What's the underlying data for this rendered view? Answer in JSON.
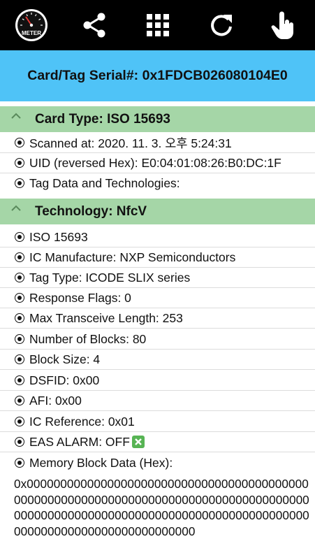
{
  "toolbar": {
    "meter_label": "METER",
    "icons": [
      "meter-icon",
      "share-icon",
      "grid-icon",
      "refresh-icon",
      "touch-icon"
    ]
  },
  "serial": {
    "text": "Card/Tag Serial#: 0x1FDCB026080104E0"
  },
  "card_section": {
    "title": "Card Type: ISO 15693",
    "items": [
      "Scanned at: 2020. 11. 3. 오후 5:24:31",
      "UID (reversed Hex): E0:04:01:08:26:B0:DC:1F",
      "Tag Data and Technologies:"
    ]
  },
  "tech_section": {
    "title": "Technology: NfcV",
    "items": [
      "ISO 15693",
      "IC Manufacture: NXP Semiconductors",
      "Tag Type: ICODE SLIX series",
      "Response Flags: 0",
      "Max Transceive Length: 253",
      "Number of Blocks: 80",
      "Block Size: 4",
      "DSFID: 0x00",
      "AFI: 0x00",
      "IC Reference: 0x01",
      "EAS ALARM: OFF",
      "Memory Block Data (Hex):"
    ]
  },
  "memory_hex": "0x0000000000000000000000000000000000000000000000000000000000000000000000000000000000000000000000000000000000000000000000000000000000000000000000000000000000000",
  "colors": {
    "toolbar": "#000000",
    "serial_bg": "#4fc3f7",
    "section_bg": "#a5d6a7",
    "check_green": "#57b454"
  }
}
